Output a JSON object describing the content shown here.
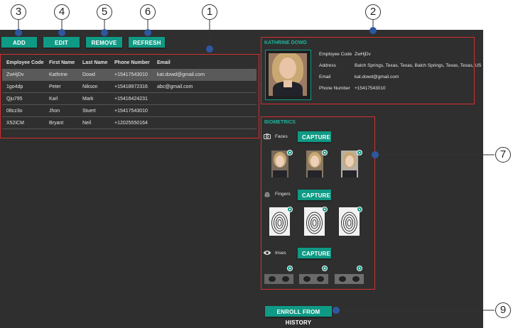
{
  "toolbar": {
    "add": "ADD",
    "edit": "EDIT",
    "remove": "REMOVE",
    "refresh": "REFRESH"
  },
  "table": {
    "headers": [
      "Employee Code",
      "First Name",
      "Last Name",
      "Phone Number",
      "Email"
    ],
    "rows": [
      [
        "ZwHjDv",
        "Kathrine",
        "Dowd",
        "+15417543010",
        "kat.dowd@gmail.com"
      ],
      [
        "1go4dp",
        "Peter",
        "Nikson",
        "+15418972316",
        "abc@gmail.com"
      ],
      [
        "Qju795",
        "Karl",
        "Mark",
        "+15416424231",
        ""
      ],
      [
        "08cz3o",
        "Jhon",
        "Stuert",
        "+15417543010",
        ""
      ],
      [
        "X52iCM",
        "Bryant",
        "Neil",
        "+12025550164",
        ""
      ]
    ],
    "selected_index": 0
  },
  "profile": {
    "name": "KATHRINE DOWD",
    "fields": [
      {
        "label": "Employee Code",
        "value": "ZwHjDv"
      },
      {
        "label": "Address",
        "value": "Balch Springs, Texas, Texas, Balch Springs, Texas, Texas, US"
      },
      {
        "label": "Email",
        "value": "kat.dowd@gmail.com"
      },
      {
        "label": "Phone Number",
        "value": "+15417543010"
      }
    ]
  },
  "biometrics": {
    "title": "BIOMETRICS",
    "faces_label": "Faces",
    "fingers_label": "Fingers",
    "irises_label": "Irises",
    "capture_label": "CAPTURE"
  },
  "enroll_label": "ENROLL FROM HISTORY",
  "callouts": [
    "1",
    "2",
    "3",
    "4",
    "5",
    "6",
    "7",
    "9"
  ],
  "colors": {
    "accent": "#0f9a85",
    "highlight": "#d32f2f",
    "background": "#2f2f2f",
    "callout_dot": "#2f57a0"
  }
}
